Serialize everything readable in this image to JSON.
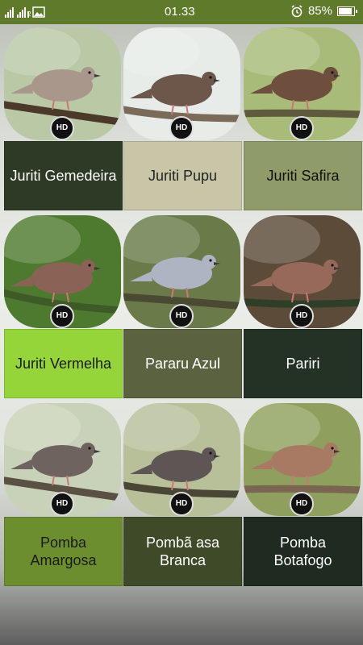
{
  "status_bar": {
    "time": "01.33",
    "battery": "85%",
    "sim2_label": "2"
  },
  "birds": [
    {
      "name": "Juriti Gemedeira",
      "bg": "#2d3a26",
      "fg": "#ffffff",
      "badge": "HD",
      "sky": "#b9c9a6",
      "body": "#a8978a",
      "branch": "#4b3a2a"
    },
    {
      "name": "Juriti Pupu",
      "bg": "#c9c6a8",
      "fg": "#222222",
      "badge": "HD",
      "sky": "#e7ece8",
      "body": "#6d574b",
      "branch": "#7a6a58"
    },
    {
      "name": "Juriti Safira",
      "bg": "#8f9c6a",
      "fg": "#111111",
      "badge": "HD",
      "sky": "#a8bb78",
      "body": "#6e4e3d",
      "branch": "#5f5a3d"
    },
    {
      "name": "Juriti Vermelha",
      "bg": "#96d53a",
      "fg": "#1b1b1b",
      "badge": "HD",
      "sky": "#4d7a2e",
      "body": "#8a6256",
      "branch": "#3e5a27"
    },
    {
      "name": "Pararu Azul",
      "bg": "#5a6240",
      "fg": "#ffffff",
      "badge": "HD",
      "sky": "#6a7a48",
      "body": "#aeb4c2",
      "branch": "#4a4a34"
    },
    {
      "name": "Pariri",
      "bg": "#243226",
      "fg": "#ffffff",
      "badge": "HD",
      "sky": "#5b4b38",
      "body": "#96695a",
      "branch": "#2f3f27"
    },
    {
      "name": "Pomba Amargosa",
      "bg": "#6c8e2f",
      "fg": "#1b1b1b",
      "badge": "HD",
      "sky": "#c8d2b8",
      "body": "#6f6360",
      "branch": "#5a5044"
    },
    {
      "name": "Pombã asa Branca",
      "bg": "#3e4a28",
      "fg": "#ffffff",
      "badge": "HD",
      "sky": "#b8c09a",
      "body": "#5e5654",
      "branch": "#4a4636"
    },
    {
      "name": "Pomba Botafogo",
      "bg": "#1f2a20",
      "fg": "#ffffff",
      "badge": "HD",
      "sky": "#8fa05e",
      "body": "#a87a64",
      "branch": "#7a6650"
    }
  ]
}
